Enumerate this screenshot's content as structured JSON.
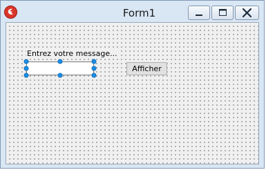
{
  "window": {
    "title": "Form1",
    "controls": {
      "minimize_icon": "minimize-icon",
      "maximize_icon": "maximize-icon",
      "close_icon": "close-icon"
    }
  },
  "form": {
    "label_text": "Entrez votre message...",
    "textbox_value": "",
    "button_label": "Afficher"
  },
  "colors": {
    "selection_handle": "#1e8fe6",
    "app_icon": "#d9362b"
  }
}
